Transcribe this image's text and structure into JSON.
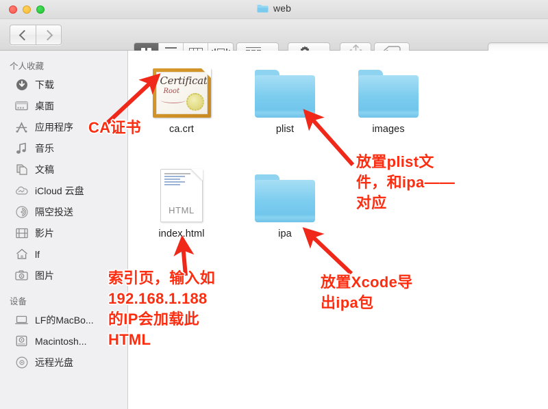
{
  "window": {
    "title": "web",
    "traffic_lights": [
      "close",
      "minimize",
      "maximize"
    ]
  },
  "toolbar": {
    "back_label": "Back",
    "forward_label": "Forward",
    "view_modes": [
      {
        "name": "icon-view",
        "selected": true
      },
      {
        "name": "list-view",
        "selected": false
      },
      {
        "name": "column-view",
        "selected": false
      },
      {
        "name": "coverflow-view",
        "selected": false
      }
    ],
    "arrange_label": "Arrange",
    "action_label": "Action",
    "share_label": "Share",
    "tag_label": "Tags",
    "search_placeholder": ""
  },
  "sidebar": {
    "sections": [
      {
        "header": "个人收藏",
        "items": [
          {
            "label": "下载",
            "icon": "download-icon"
          },
          {
            "label": "桌面",
            "icon": "desktop-icon"
          },
          {
            "label": "应用程序",
            "icon": "applications-icon"
          },
          {
            "label": "音乐",
            "icon": "music-icon"
          },
          {
            "label": "文稿",
            "icon": "documents-icon"
          },
          {
            "label": "iCloud 云盘",
            "icon": "icloud-icon"
          },
          {
            "label": "隔空投送",
            "icon": "airdrop-icon"
          },
          {
            "label": "影片",
            "icon": "movies-icon"
          },
          {
            "label": "lf",
            "icon": "home-icon"
          },
          {
            "label": "图片",
            "icon": "pictures-icon"
          }
        ]
      },
      {
        "header": "设备",
        "items": [
          {
            "label": "LF的MacBo...",
            "icon": "laptop-icon"
          },
          {
            "label": "Macintosh...",
            "icon": "harddisk-icon"
          },
          {
            "label": "远程光盘",
            "icon": "disc-icon"
          }
        ]
      }
    ]
  },
  "files": [
    {
      "name": "ca.crt",
      "kind": "certificate"
    },
    {
      "name": "plist",
      "kind": "folder"
    },
    {
      "name": "images",
      "kind": "folder"
    },
    {
      "name": "index.html",
      "kind": "html-document",
      "type_badge": "HTML"
    },
    {
      "name": "ipa",
      "kind": "folder"
    }
  ],
  "certificate_icon": {
    "heading": "Certificate",
    "subheading": "Root"
  },
  "annotations": [
    {
      "id": "ca-note",
      "text": "CA证书"
    },
    {
      "id": "plist-note",
      "text": "放置plist文\n件，和ipa——\n对应"
    },
    {
      "id": "index-note",
      "text": "索引页，输入如\n192.168.1.188\n的IP会加载此\nHTML"
    },
    {
      "id": "ipa-note",
      "text": "放置Xcode导\n出ipa包"
    }
  ],
  "colors": {
    "annotation_red": "#fc2e12",
    "folder_blue": "#79cbee",
    "toolbar_gray": "#e2e2e2",
    "sidebar_gray": "#f0f0f2"
  }
}
